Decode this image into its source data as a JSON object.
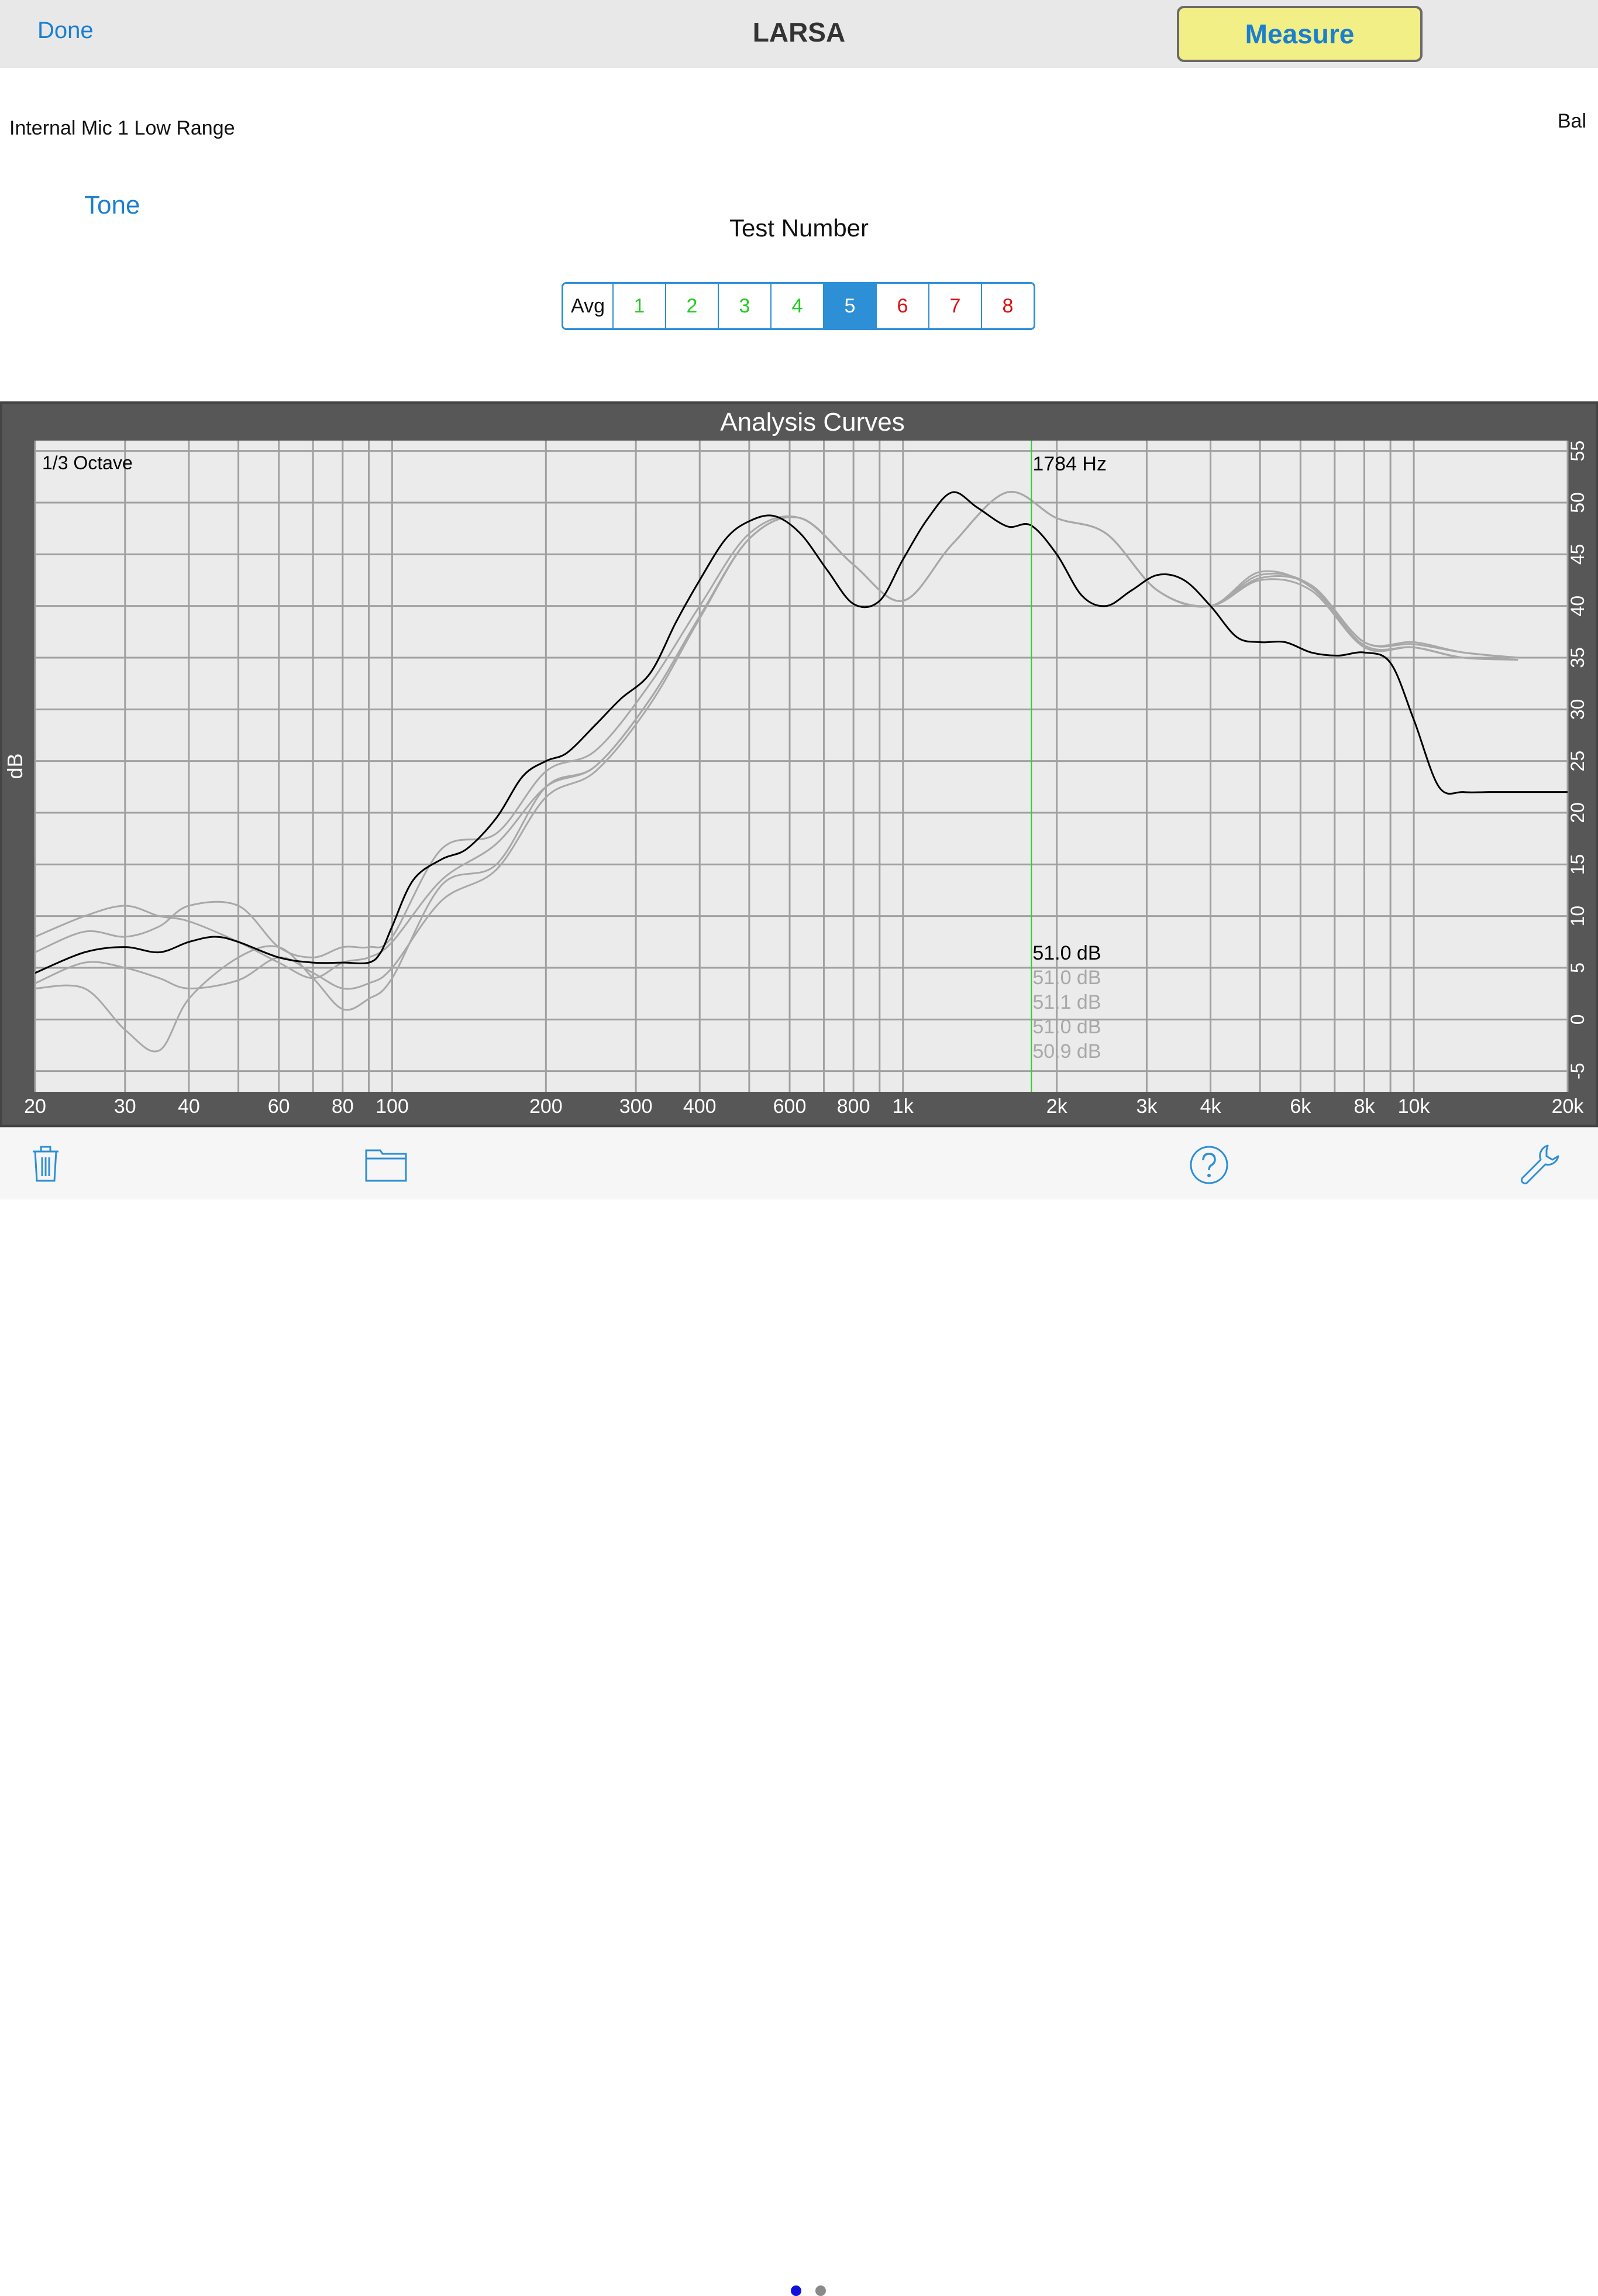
{
  "nav": {
    "done_label": "Done",
    "title": "LARSA",
    "measure_label": "Measure"
  },
  "input_label": "Internal Mic 1 Low Range",
  "bal_label": "Bal",
  "tone_label": "Tone",
  "test_number_label": "Test Number",
  "tests": [
    {
      "label": "Avg",
      "color": "#111111"
    },
    {
      "label": "1",
      "color": "#22cc22"
    },
    {
      "label": "2",
      "color": "#22cc22"
    },
    {
      "label": "3",
      "color": "#22cc22"
    },
    {
      "label": "4",
      "color": "#22cc22"
    },
    {
      "label": "5",
      "color": "#ffffff"
    },
    {
      "label": "6",
      "color": "#dd1111"
    },
    {
      "label": "7",
      "color": "#dd1111"
    },
    {
      "label": "8",
      "color": "#dd1111"
    }
  ],
  "selected_test": "5",
  "toolbar": {
    "icons": [
      "trash-icon",
      "folder-icon",
      "help-icon",
      "wrench-icon"
    ],
    "page_count": 2,
    "current_page": 1
  },
  "colors": {
    "accent": "#2d8fd5",
    "measure_button": "#f2ef86",
    "cursor_line": "#33cc33",
    "avg_curve": "#000000",
    "test_curves": "#a8a8a8",
    "plot_bg": "#ebebeb",
    "frame": "#575757"
  },
  "chart_data": {
    "type": "line",
    "title": "Analysis Curves",
    "xlabel": "",
    "ylabel": "dB",
    "xscale": "log",
    "xlim": [
      20,
      20000
    ],
    "ylim": [
      -7,
      56
    ],
    "x_tick_labels": [
      "20",
      "30",
      "40",
      "60",
      "80",
      "100",
      "200",
      "300",
      "400",
      "600",
      "800",
      "1k",
      "2k",
      "3k",
      "4k",
      "6k",
      "8k",
      "10k",
      "20k"
    ],
    "x_tick_values": [
      20,
      30,
      40,
      60,
      80,
      100,
      200,
      300,
      400,
      600,
      800,
      1000,
      2000,
      3000,
      4000,
      6000,
      8000,
      10000,
      20000
    ],
    "y_tick_labels": [
      "-5",
      "0",
      "5",
      "10",
      "15",
      "20",
      "25",
      "30",
      "35",
      "40",
      "45",
      "50",
      "55"
    ],
    "y_tick_values": [
      -5,
      0,
      5,
      10,
      15,
      20,
      25,
      30,
      35,
      40,
      45,
      50,
      55
    ],
    "grid": true,
    "resolution_label": "1/3 Octave",
    "cursor": {
      "frequency": 1784,
      "label": "1784 Hz"
    },
    "cursor_readouts": [
      {
        "label": "51.0 dB",
        "color": "#000000"
      },
      {
        "label": "51.0 dB",
        "color": "#a8a8a8"
      },
      {
        "label": "51.1 dB",
        "color": "#a8a8a8"
      },
      {
        "label": "51.0 dB",
        "color": "#a8a8a8"
      },
      {
        "label": "50.9 dB",
        "color": "#a8a8a8"
      }
    ],
    "series": [
      {
        "role": "average",
        "color": "#000000",
        "x": [
          20,
          25,
          30,
          35,
          40,
          45,
          50,
          60,
          70,
          80,
          90,
          95,
          100,
          110,
          125,
          140,
          160,
          180,
          200,
          220,
          250,
          280,
          320,
          360,
          400,
          450,
          500,
          560,
          630,
          710,
          800,
          900,
          1000,
          1120,
          1250,
          1400,
          1600,
          1780,
          2000,
          2240,
          2500,
          2800,
          3150,
          3550,
          4000,
          4500,
          5000,
          5600,
          6300,
          7100,
          8000,
          9000,
          10000,
          11200,
          12500,
          14000,
          16000,
          18000,
          20000
        ],
        "y": [
          4.5,
          6.5,
          7,
          6.5,
          7.5,
          8,
          7.5,
          6,
          5.5,
          5.5,
          5.5,
          6.5,
          9,
          13.5,
          15.5,
          16.5,
          19.5,
          23.5,
          25,
          25.8,
          28.5,
          31,
          33.5,
          38.5,
          42.5,
          46.5,
          48.2,
          48.7,
          47,
          43.5,
          40.2,
          40.5,
          44.5,
          48.5,
          51,
          49.5,
          47.7,
          47.8,
          45,
          41,
          40,
          41.5,
          43,
          42.5,
          40,
          37,
          36.5,
          36.5,
          35.5,
          35.2,
          35.5,
          34.5,
          29,
          22.5,
          22,
          22,
          22,
          22,
          22
        ]
      },
      {
        "role": "test",
        "color": "#a8a8a8",
        "x": [
          20,
          25,
          30,
          35,
          40,
          50,
          60,
          70,
          80,
          90,
          100,
          125,
          160,
          200,
          250,
          320,
          400,
          500,
          630,
          800,
          1000,
          1250,
          1600,
          2000,
          2500,
          3150,
          4000,
          5000,
          6300,
          8000,
          10000,
          12500,
          16000
        ],
        "y": [
          8,
          10,
          11,
          10,
          9.5,
          7.5,
          5.5,
          4,
          5.5,
          6,
          7.5,
          13.5,
          17,
          22.5,
          24.5,
          31,
          39,
          46.5,
          48.5,
          44,
          40.5,
          46,
          51,
          48.5,
          47,
          41.5,
          40,
          43.3,
          41.8,
          36.2,
          36,
          35,
          35
        ]
      },
      {
        "role": "test",
        "color": "#a8a8a8",
        "x": [
          20,
          25,
          30,
          35,
          40,
          50,
          60,
          70,
          80,
          90,
          100,
          125,
          160,
          200,
          250,
          320,
          400,
          500,
          630,
          800,
          1000,
          1250,
          1600,
          2000,
          2500,
          3150,
          4000,
          5000,
          6300,
          8000,
          10000,
          12500,
          16000
        ],
        "y": [
          6.5,
          8.5,
          8,
          9,
          11,
          11,
          7,
          6,
          7,
          7,
          8,
          16.5,
          18,
          24,
          26,
          32.5,
          40,
          47,
          48.5,
          44,
          40.5,
          46,
          51,
          48.5,
          47,
          41.5,
          40,
          43,
          42,
          36.5,
          36.5,
          35.5,
          35
        ]
      },
      {
        "role": "test",
        "color": "#a8a8a8",
        "x": [
          20,
          25,
          30,
          35,
          40,
          50,
          60,
          70,
          80,
          90,
          100,
          125,
          160,
          200,
          250,
          320,
          400,
          500,
          630,
          800,
          1000,
          1250,
          1600,
          2000,
          2500,
          3150,
          4000,
          5000,
          6300,
          8000,
          10000,
          12500,
          16000
        ],
        "y": [
          3,
          3,
          -1,
          -3,
          2,
          6,
          7,
          4,
          1,
          2,
          4,
          13,
          15,
          22.5,
          24.5,
          31,
          39,
          46.5,
          48.5,
          44,
          40.5,
          46,
          51,
          48.5,
          47,
          41.5,
          40,
          42.7,
          42,
          36.5,
          36.3,
          35.5,
          35
        ]
      },
      {
        "role": "test",
        "color": "#a8a8a8",
        "x": [
          20,
          25,
          30,
          35,
          40,
          50,
          60,
          70,
          80,
          90,
          100,
          125,
          160,
          200,
          250,
          320,
          400,
          500,
          630,
          800,
          1000,
          1250,
          1600,
          2000,
          2500,
          3150,
          4000,
          5000,
          6300,
          8000,
          10000,
          12500,
          16000
        ],
        "y": [
          3.5,
          5.5,
          5,
          4,
          3,
          3.8,
          6,
          4.5,
          3,
          3.5,
          5,
          11.5,
          14.5,
          21.5,
          24,
          30.5,
          38.8,
          46.5,
          48.5,
          44,
          40.5,
          46,
          51,
          48.5,
          47,
          41.5,
          40,
          42.5,
          41.5,
          36,
          36,
          35,
          34.8
        ]
      }
    ]
  }
}
